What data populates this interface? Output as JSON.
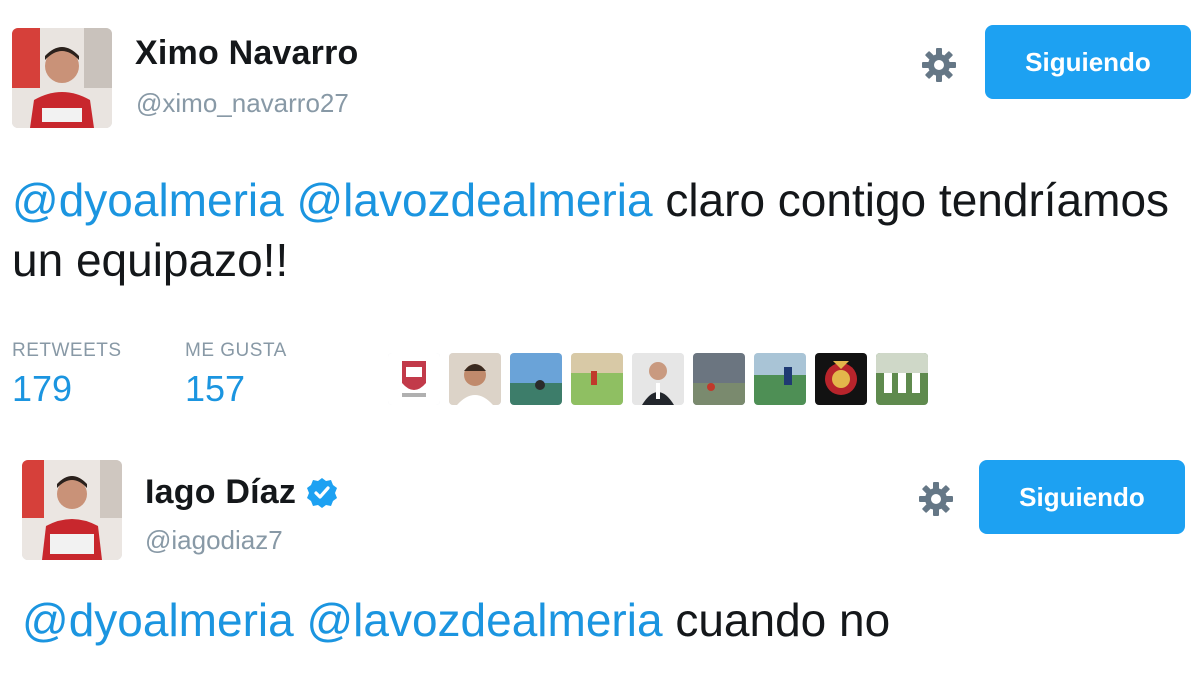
{
  "tweets": [
    {
      "user": {
        "name": "Ximo Navarro",
        "handle": "@ximo_navarro27",
        "verified": false
      },
      "follow_label": "Siguiendo",
      "text": {
        "mention1": "@dyoalmeria",
        "mention2": "@lavozdealmeria",
        "body": " claro contigo tendríamos un equipazo!!"
      },
      "stats": {
        "retweets_label": "RETWEETS",
        "retweets": "179",
        "likes_label": "ME GUSTA",
        "likes": "157"
      },
      "likers": [
        "liker-logo",
        "liker-person",
        "liker-beach",
        "liker-field",
        "liker-suit",
        "liker-stadium",
        "liker-pitch",
        "liker-crest",
        "liker-team"
      ]
    },
    {
      "user": {
        "name": "Iago Díaz",
        "handle": "@iagodiaz7",
        "verified": true
      },
      "follow_label": "Siguiendo",
      "text": {
        "mention1": "@dyoalmeria",
        "mention2": "@lavozdealmeria",
        "body": " cuando no"
      }
    }
  ],
  "icons": {
    "settings": "gear-icon",
    "verified": "verified-badge-icon"
  },
  "colors": {
    "accent": "#1da1f2",
    "mention": "#1b95e0",
    "secondary_text": "#8899a6"
  }
}
